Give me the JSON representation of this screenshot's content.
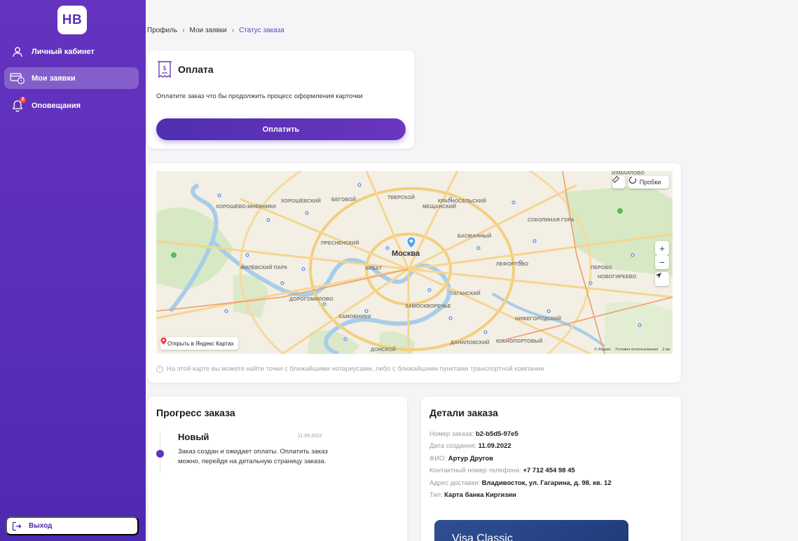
{
  "sidebar": {
    "logo": "НВ",
    "items": [
      {
        "label": "Личный кабинет",
        "icon": "user-icon"
      },
      {
        "label": "Мои заявки",
        "icon": "card-clock-icon",
        "active": true
      },
      {
        "label": "Оповещания",
        "icon": "bell-icon",
        "badge": "2"
      }
    ],
    "exit_label": "Выход"
  },
  "breadcrumbs": [
    "Профиль",
    "Мои заявки",
    "Статус заказа"
  ],
  "payment": {
    "title": "Оплата",
    "description": "Оплатите заказ что бы продолжить процесс оформления карточки",
    "button": "Оплатить"
  },
  "map": {
    "city": "Москва",
    "traffic_label": "Пробки",
    "open_label": "Открыть в Яндекс Картах",
    "zoom_in": "+",
    "zoom_out": "−",
    "scale": "2 км",
    "attribution": [
      "© Яндекс",
      "Условия использования"
    ],
    "labels": [
      "ХОРОШЁВО-МНЁВНИКИ",
      "ХОРОШЁВСКИЙ",
      "БЕГОВОЙ",
      "ТВЕРСКОЙ",
      "МЕЩАНСКИЙ",
      "КРАСНОСЕЛЬСКИЙ",
      "БАСМАННЫЙ",
      "СОКОЛИНАЯ ГОРА",
      "ИЗМАЙЛОВО",
      "ПРЕСНЕНСКИЙ",
      "АРБАТ",
      "ЛЕФОРТОВО",
      "ПЕРОВО",
      "НОВОГИРЕЕВО",
      "ФИЛЁВСКИЙ ПАРК",
      "ДОРОГОМИЛОВО",
      "ХАМОВНИКИ",
      "ЗАМОСКВОРЕЧЬЕ",
      "ТАГАНСКИЙ",
      "НИЖЕГОРОДСКИЙ",
      "ДОНСКОЙ",
      "ДАНИЛОВСКИЙ",
      "ЮЖНОПОРТОВЫЙ"
    ],
    "note": "На этой карте вы можете найти точки с ближайшими нотариусами, либо с ближайшими пунктами транспортной компании"
  },
  "progress": {
    "title": "Прогресс заказа",
    "status": "Новый",
    "date": "11.09.2022",
    "description": "Заказ создан и ожидает оплаты. Оплатить заказ можно, перейдя на детальную страницу заказа."
  },
  "details": {
    "title": "Детали заказа",
    "rows": [
      {
        "label": "Номер заказа:",
        "value": "b2-b5d5-97e5"
      },
      {
        "label": "Дата создания:",
        "value": "11.09.2022"
      },
      {
        "label": "ФИО:",
        "value": "Артур Другов"
      },
      {
        "label": "Контактный номер телефона:",
        "value": "+7 712 454 98 45"
      },
      {
        "label": "Адрес доставки:",
        "value": "Владивосток, ул. Гагарина, д. 98. кв. 12"
      },
      {
        "label": "Тип:",
        "value": "Карта банка Киргизии"
      }
    ],
    "card_name": "Visa Classic"
  },
  "colors": {
    "accent": "#5b2fb8",
    "sidebar_top": "#6533bf",
    "sidebar_bottom": "#4e2ab0",
    "link": "#5b3fc7"
  }
}
